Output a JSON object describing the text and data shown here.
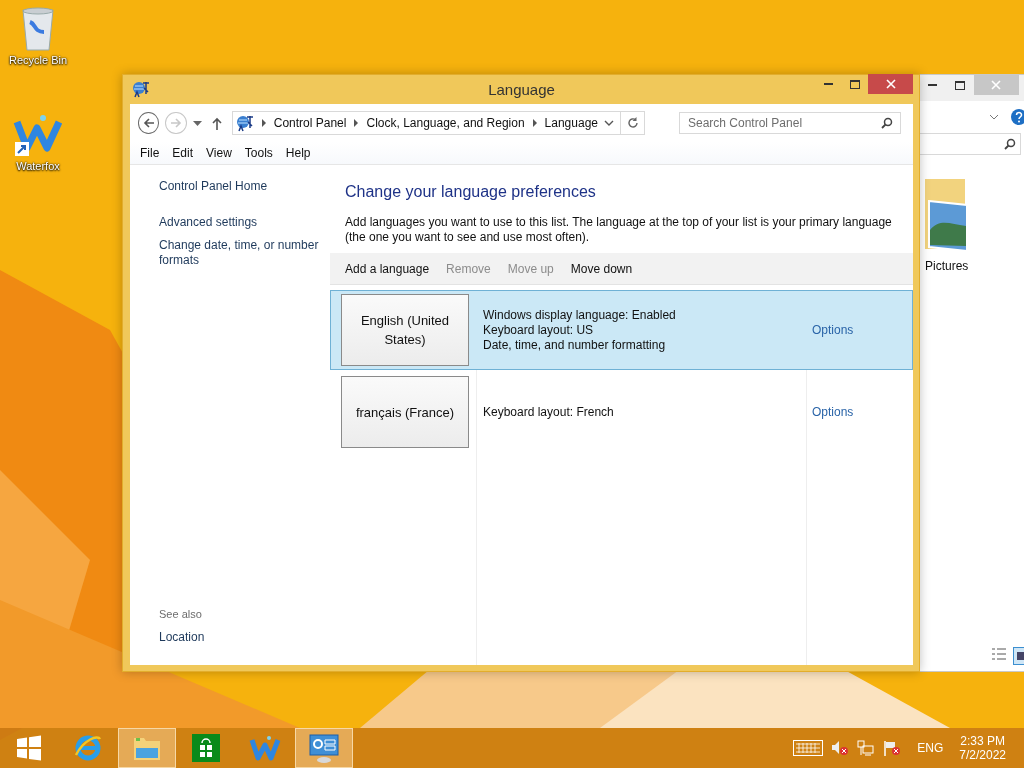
{
  "desktop_icons": [
    {
      "kind": "recycle",
      "label": "Recycle Bin"
    },
    {
      "kind": "waterfox",
      "label": "Waterfox"
    }
  ],
  "background_window": {
    "items": [
      {
        "label": "Pictures"
      }
    ]
  },
  "window": {
    "title": "Language",
    "breadcrumb": [
      "Control Panel",
      "Clock, Language, and Region",
      "Language"
    ],
    "search": {
      "placeholder": "Search Control Panel"
    },
    "menu": [
      "File",
      "Edit",
      "View",
      "Tools",
      "Help"
    ],
    "sidebar": {
      "links": [
        "Control Panel Home",
        "Advanced settings",
        "Change date, time, or number formats"
      ],
      "see_also_heading": "See also",
      "see_also": [
        "Location"
      ]
    },
    "heading": "Change your language preferences",
    "description": "Add languages you want to use to this list. The language at the top of your list is your primary language (the one you want to see and use most often).",
    "toolbar": [
      {
        "label": "Add a language",
        "disabled": false
      },
      {
        "label": "Remove",
        "disabled": true
      },
      {
        "label": "Move up",
        "disabled": true
      },
      {
        "label": "Move down",
        "disabled": false
      }
    ],
    "languages": [
      {
        "name": "English (United States)",
        "details": [
          "Windows display language: Enabled",
          "Keyboard layout: US",
          "Date, time, and number formatting"
        ],
        "options": "Options",
        "selected": true
      },
      {
        "name": "français (France)",
        "details": [
          "Keyboard layout: French"
        ],
        "options": "Options",
        "selected": false
      }
    ]
  },
  "taskbar": {
    "apps": [
      {
        "kind": "start",
        "active": false
      },
      {
        "kind": "browser",
        "active": false
      },
      {
        "kind": "explorer",
        "active": true
      },
      {
        "kind": "store",
        "active": false
      },
      {
        "kind": "waterfox",
        "active": false
      },
      {
        "kind": "control-panel",
        "active": true
      }
    ],
    "language": "ENG",
    "time": "2:33 PM",
    "date": "7/2/2022"
  }
}
